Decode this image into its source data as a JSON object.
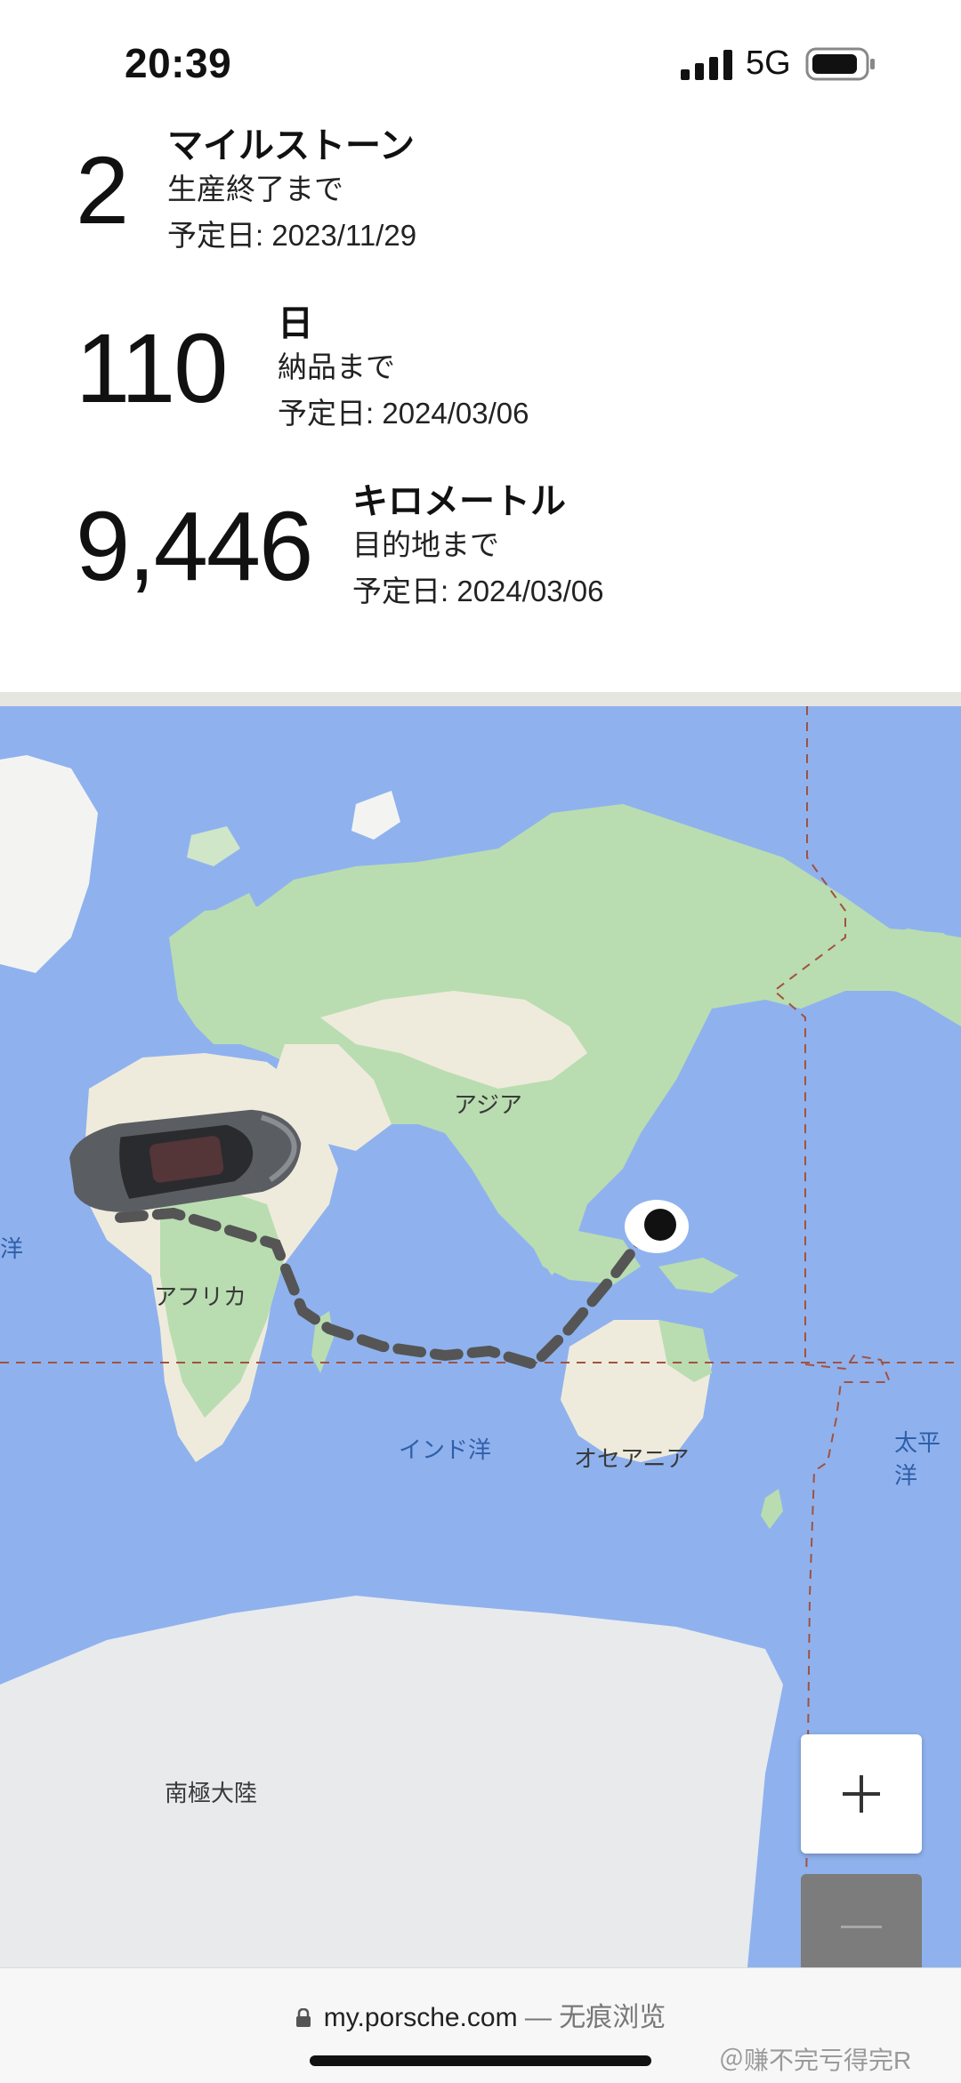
{
  "status_bar": {
    "time": "20:39",
    "network": "5G",
    "icons": [
      "signal-icon",
      "battery-icon"
    ]
  },
  "stats": [
    {
      "value": "2",
      "unit": "マイルストーン",
      "subtitle": "生産終了まで",
      "date": "予定日: 2023/11/29"
    },
    {
      "value": "110",
      "unit": "日",
      "subtitle": "納品まで",
      "date": "予定日: 2024/03/06"
    },
    {
      "value": "9,446",
      "unit": "キロメートル",
      "subtitle": "目的地まで",
      "date": "予定日: 2024/03/06"
    }
  ],
  "map": {
    "labels": {
      "asia": "アジア",
      "africa": "アフリカ",
      "oceania": "オセアニア",
      "antarctica": "南極大陸",
      "indian_ocean": "インド洋",
      "pacific": "太平洋",
      "atlantic_fragment": "西洋"
    },
    "zoom_in_icon": "plus-icon",
    "zoom_out_icon": "minus-icon",
    "colors": {
      "ocean": "#8fb2ee",
      "land": "#cfe6c9",
      "route": "#555555"
    }
  },
  "browser": {
    "url": "my.porsche.com",
    "separator": "—",
    "mode": "无痕浏览"
  },
  "watermark": "＠赚不完亏得完R"
}
